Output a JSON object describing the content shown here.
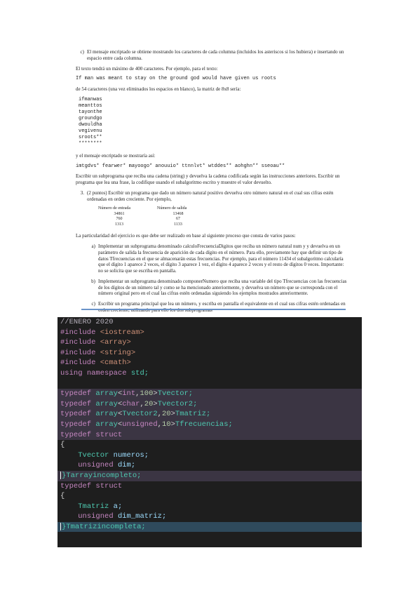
{
  "document": {
    "item_c_label": "c)",
    "item_c_text": "El mensaje encriptado se obtiene mostrando los caracteres de cada columna (incluidos los asteriscos si los hubiera) e insertando un espacio entre cada columna.",
    "p_max": "El texto tendrá un máximo de 400 caracteres. Por ejemplo, para el texto:",
    "example_text": "If man was meant to stay on the ground god would have given us roots",
    "p_length": "de 54 caracteres (una vez eliminados los espacios en blanco), la matriz de 8x8 sería:",
    "matrix_rows": [
      "ifmanwas",
      "meanttos",
      "tayonthe",
      "groundgo",
      "dwouldha",
      "vegivenu",
      "sroots**",
      "********"
    ],
    "p_encrypted_intro": "y el mensaje encriptado se mostraría así:",
    "encrypted_message": "imtgdvs* fearwer* mayoogo* anouuio* ttnnlvt* wtddes** aohghn** sseoau**",
    "p_subprogram": "Escribir un subprograma que reciba una cadena (string) y devuelva la cadena codificada según las instrucciones anteriores. Escribir un programa que lea una frase, la codifique usando el subalgoritmo escrito y muestre el valor devuelto.",
    "ex3_label": "3.",
    "ex3_text": "(2 puntos) Escribir un programa que dado un número natural positivo devuelva otro número natural en el cual sus cifras estén ordenadas en orden creciente. Por ejemplo,",
    "table_header_in": "Número de entrada",
    "table_header_out": "Número de salida",
    "table_rows": [
      [
        "34861",
        "13468"
      ],
      [
        "760",
        "67"
      ],
      [
        "1313",
        "1133"
      ]
    ],
    "p_particularity": "La particularidad del ejercicio es que debe ser realizado en base al siguiente proceso que consta de varios pasos:",
    "sub_a_label": "a)",
    "sub_a_text": "Implementar un subprograma denominado calculoFrecuenciaDigitos que reciba un número natural num y y devuelva en un parámetro de salida la frecuencia de aparición de cada dígito en el número. Para ello, previamente hay que definir un tipo de datos Tfrecuencias en el que se almacenarán estas frecuencias. Por ejemplo, para el número 11434 el subalgoritmo calcularía que el dígito 1 aparece 2 veces, el dígito 3 aparece 1 vez, el dígito 4 aparece 2 veces y el resto de dígitos 0 veces. Importante: no se solicita que se escriba en pantalla.",
    "sub_b_label": "b)",
    "sub_b_text": "Implementar un subprograma denominado componerNumero que reciba una variable del tipo Tfrecuencias con las frecuencias de los dígitos de un número tal y como se ha mencionado anteriormente, y devuelva un número que se corresponda con el número original pero en el cual las cifras estén ordenadas siguiendo los ejemplos mostrados anteriormente.",
    "sub_c_label": "c)",
    "sub_c_text": "Escribir un programa principal que lea un número, y escriba en pantalla el equivalente en el cual sus cifras estén ordenadas en orden creciente, utilizando para ello los dos subprogramas"
  },
  "code": {
    "comment": "//ENERO 2020",
    "kw_include": "#include",
    "inc_iostream": "<iostream>",
    "inc_array": "<array>",
    "inc_string": "<string>",
    "inc_cmath": "<cmath>",
    "kw_using": "using",
    "kw_namespace": "namespace",
    "ns_std": "std;",
    "kw_typedef": "typedef",
    "kw_array": "array",
    "t_int": "int",
    "n_100": "100",
    "name_tvector": "Tvector;",
    "t_char": "char",
    "n_20": "20",
    "name_tvector2": "Tvector2;",
    "t_tvector2": "Tvector2",
    "name_tmatriz": "Tmatriz;",
    "t_unsigned": "unsigned",
    "n_10": "10",
    "name_tfrecuencias": "Tfrecuencias;",
    "kw_struct": "struct",
    "brace_open": "{",
    "t_tvector": "Tvector",
    "f_numeros": "numeros;",
    "f_dim": "dim;",
    "close_tarray": "}Tarrayincompleto;",
    "t_tmatriz": "Tmatriz",
    "f_a": "a;",
    "f_dim_matriz": "dim_matriz;",
    "close_tmatriz": "}Tmatrizincompleta;",
    "colors": {
      "background": "#1e1e1e",
      "comment": "#b4aeb9",
      "keyword": "#c586c0",
      "type": "#4ec9b0",
      "string": "#ce9178",
      "number": "#b5cea8",
      "identifier": "#9cdcfe"
    }
  }
}
